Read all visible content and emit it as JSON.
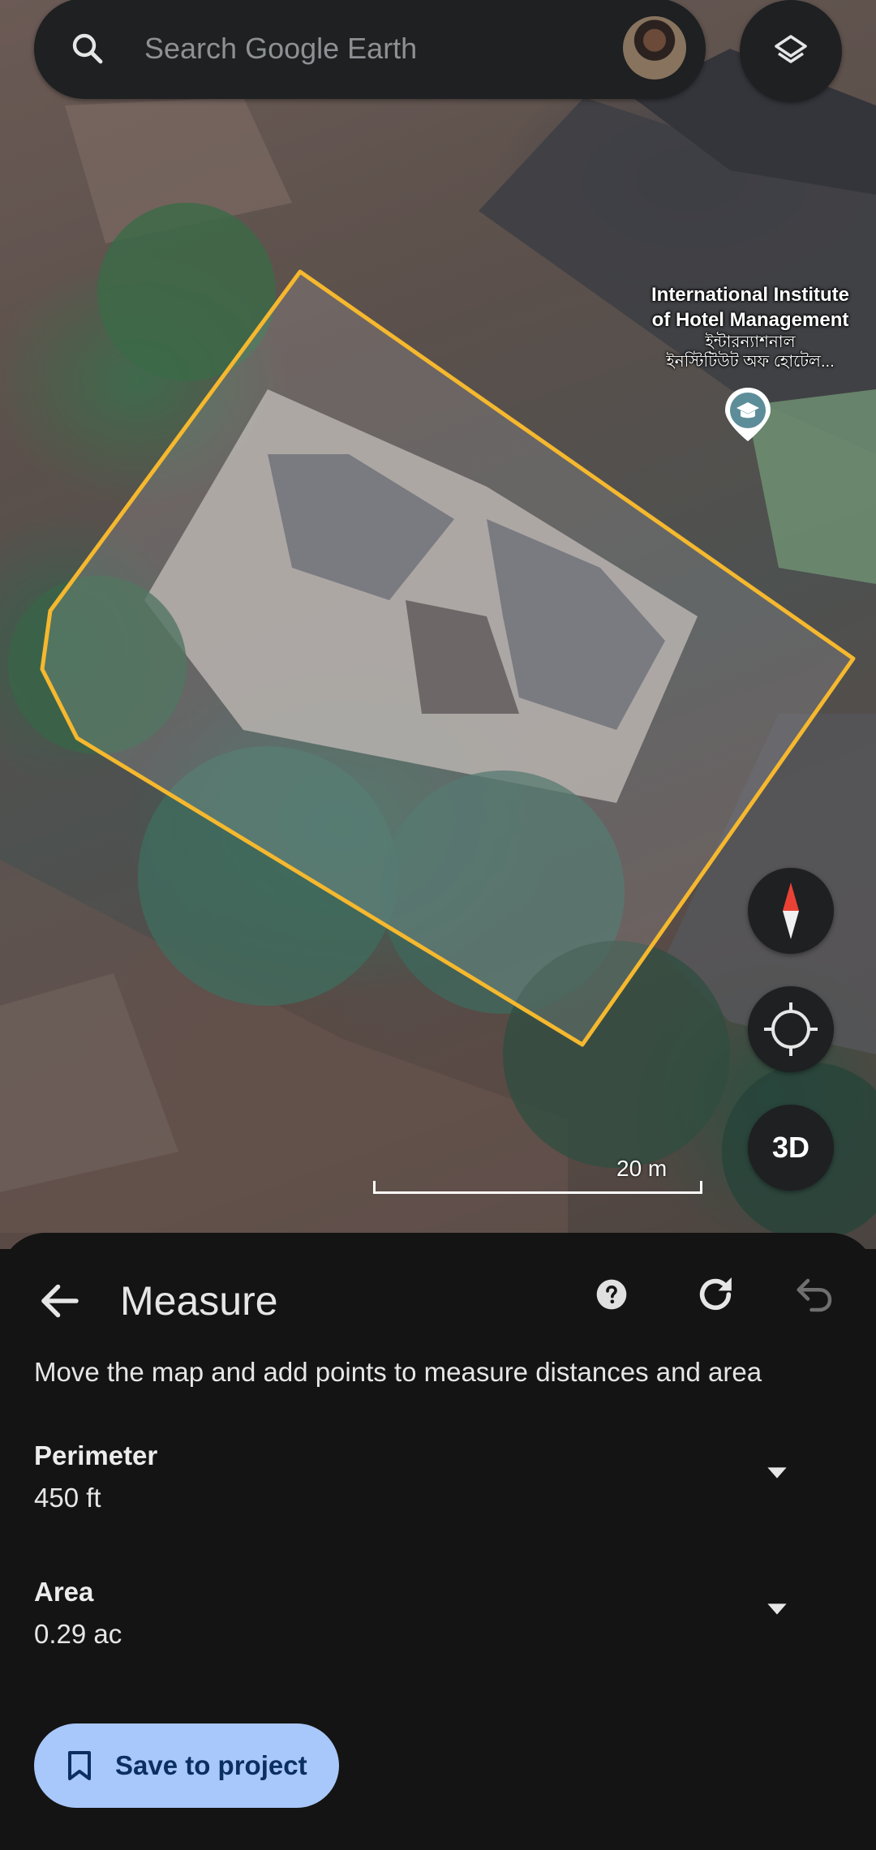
{
  "search": {
    "placeholder": "Search Google Earth"
  },
  "map": {
    "place_name": [
      "International Institute",
      "of Hotel Management"
    ],
    "place_name_bengali": [
      "ইন্টারন্যাশনাল",
      "ইনস্টিটিউট অফ হোটেল..."
    ],
    "scale_label": "20 m",
    "fab_3d_label": "3D",
    "polygon_color": "#f5b82e"
  },
  "measure": {
    "title": "Measure",
    "instructions": "Move the map and add points to measure distances and area",
    "perimeter": {
      "label": "Perimeter",
      "value": "450 ft"
    },
    "area": {
      "label": "Area",
      "value": "0.29 ac"
    },
    "save_label": "Save to project"
  },
  "icons": {
    "search": "search-icon",
    "layers": "layers-icon",
    "compass": "compass-icon",
    "my_location": "my-location-icon",
    "back": "back-arrow-icon",
    "help": "help-icon",
    "redo": "redo-icon",
    "undo": "undo-icon",
    "caret": "caret-down-icon",
    "bookmark": "bookmark-icon"
  },
  "colors": {
    "accent_button": "#a8c7fa",
    "sheet_bg": "#141414",
    "fab_bg": "#1e2022"
  }
}
